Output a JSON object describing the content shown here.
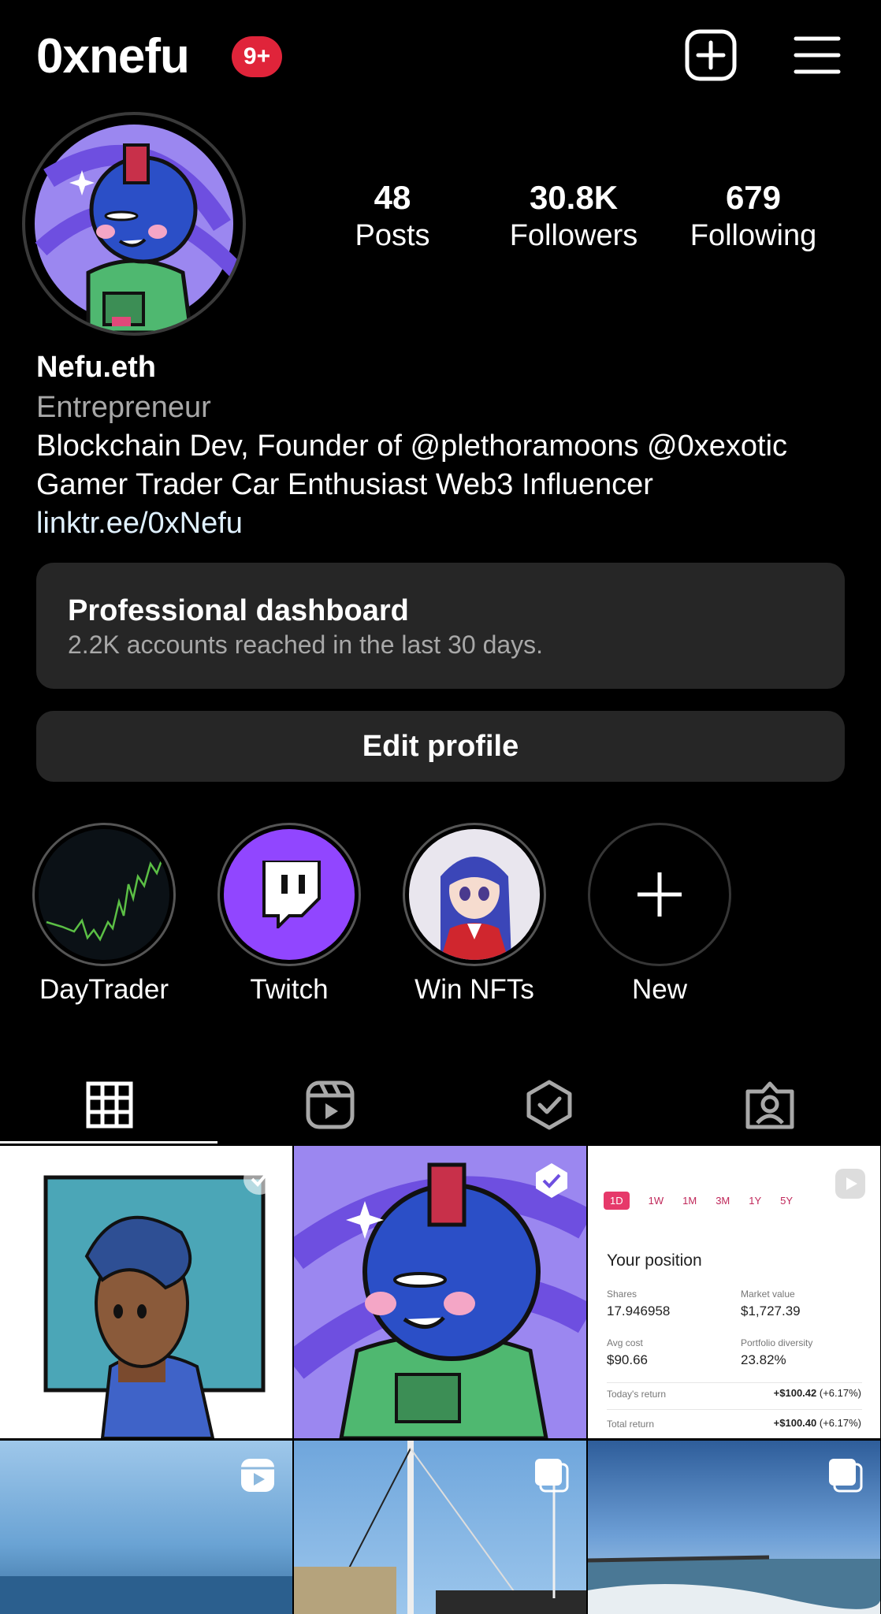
{
  "header": {
    "username": "0xnefu",
    "notification_badge": "9+",
    "new_post_icon": "plus-square-icon",
    "menu_icon": "hamburger-menu-icon"
  },
  "profile": {
    "stats": [
      {
        "value": "48",
        "label": "Posts"
      },
      {
        "value": "30.8K",
        "label": "Followers"
      },
      {
        "value": "679",
        "label": "Following"
      }
    ]
  },
  "bio": {
    "name": "Nefu.eth",
    "category": "Entrepreneur",
    "line1": "Blockchain Dev, Founder of @plethoramoons @0xexotic",
    "line2": "Gamer Trader Car Enthusiast Web3 Influencer",
    "link": "linktr.ee/0xNefu"
  },
  "dashboard": {
    "title": "Professional dashboard",
    "subtitle": "2.2K accounts reached in the last 30 days."
  },
  "edit_profile_label": "Edit profile",
  "highlights": [
    {
      "label": "DayTrader"
    },
    {
      "label": "Twitch"
    },
    {
      "label": "Win NFTs"
    },
    {
      "label": "New"
    }
  ],
  "tabs": [
    {
      "icon": "grid-icon",
      "active": true
    },
    {
      "icon": "reels-icon",
      "active": false
    },
    {
      "icon": "check-badge-icon",
      "active": false
    },
    {
      "icon": "tagged-person-icon",
      "active": false
    }
  ],
  "position_card": {
    "ranges": [
      "1D",
      "1W",
      "1M",
      "3M",
      "1Y",
      "5Y"
    ],
    "title": "Your position",
    "shares_label": "Shares",
    "shares_value": "17.946958",
    "market_value_label": "Market value",
    "market_value": "$1,727.39",
    "avg_cost_label": "Avg cost",
    "avg_cost_value": "$90.66",
    "diversity_label": "Portfolio diversity",
    "diversity_value": "23.82%",
    "today_return_label": "Today's return",
    "today_return_value": "+$100.42",
    "today_return_pct": "(+6.17%)",
    "total_return_label": "Total return",
    "total_return_value": "+$100.40",
    "total_return_pct": "(+6.17%)"
  },
  "colors": {
    "background": "#000000",
    "card": "#262626",
    "badge": "#e0243a",
    "twitch": "#9146ff",
    "link": "#e0f1ff"
  }
}
